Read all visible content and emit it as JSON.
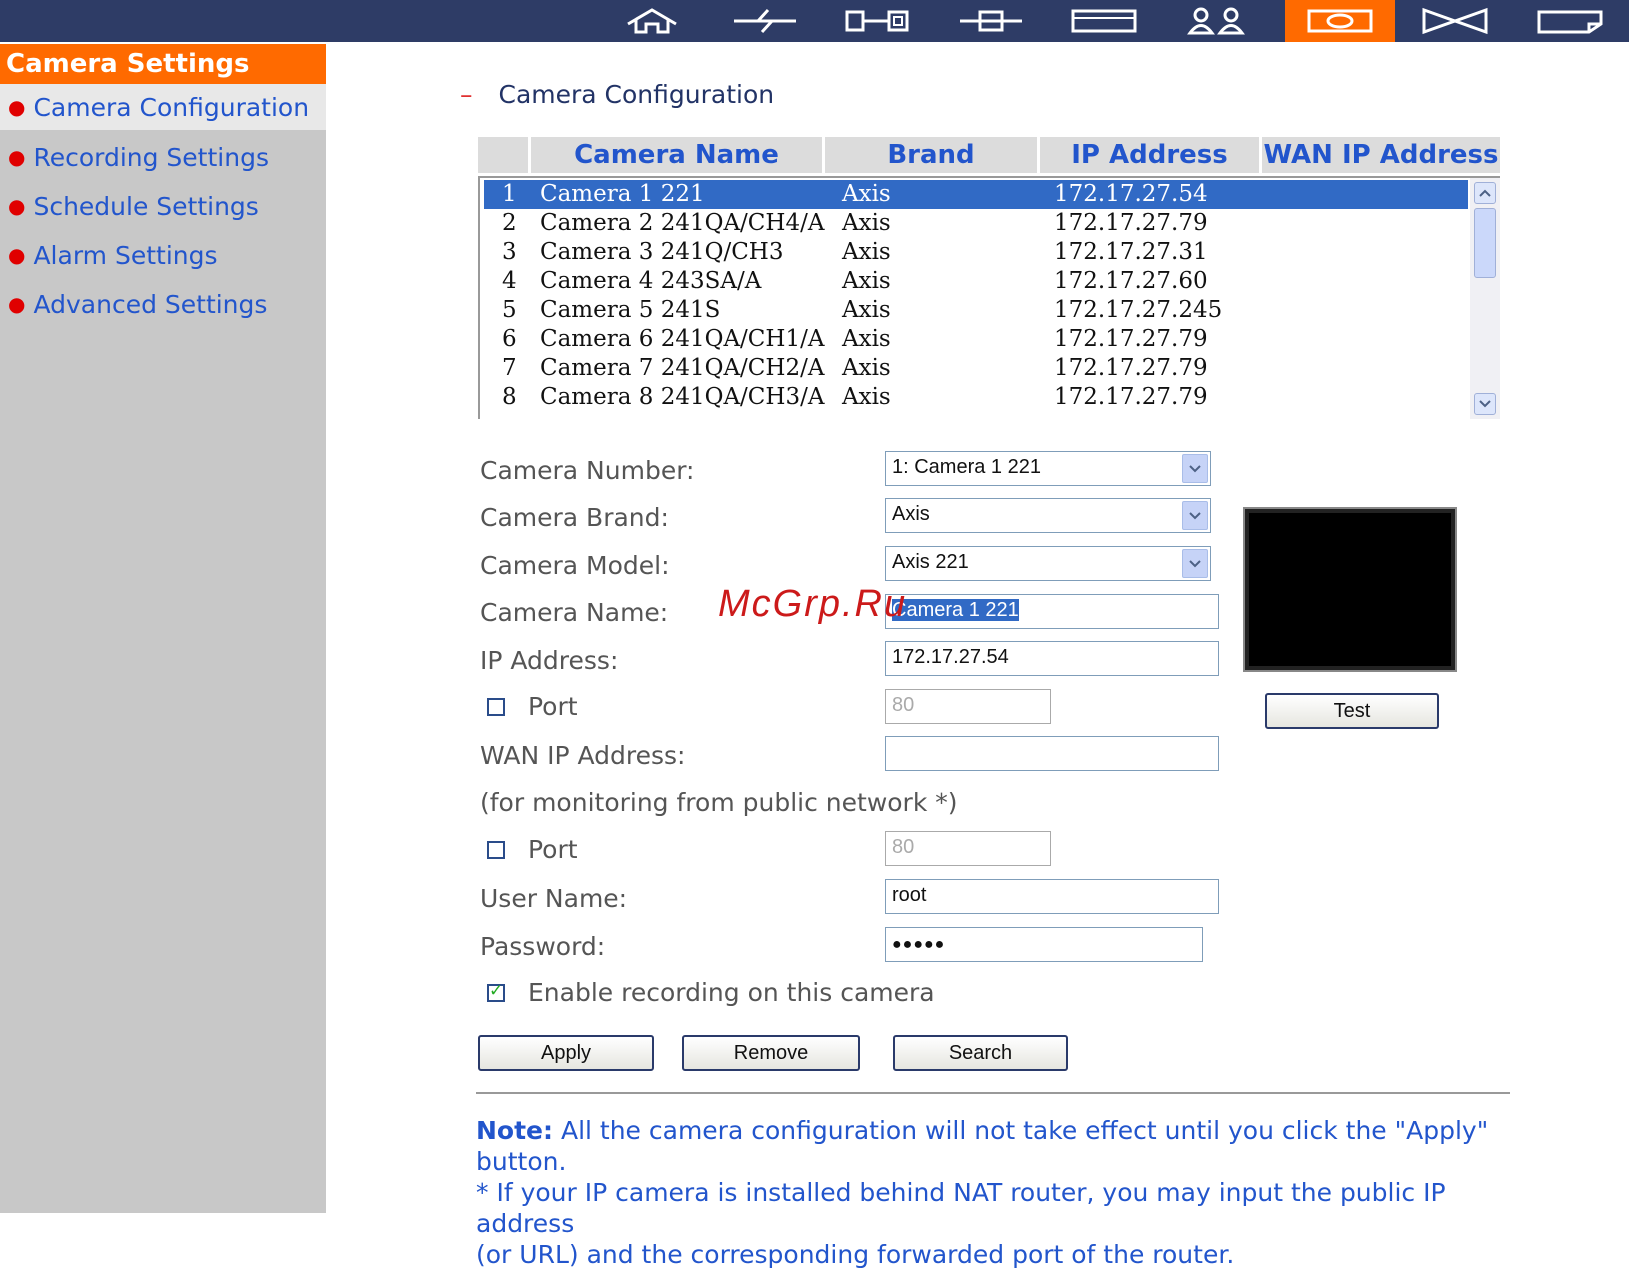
{
  "topbar": {
    "icons": [
      "home-icon",
      "network-icon",
      "device-icon",
      "plugin-icon",
      "window-icon",
      "users-icon",
      "camera-icon",
      "hourglass-icon",
      "monitor-icon"
    ],
    "active_index": 6,
    "bg_color": "#2e3c66",
    "active_color": "#ff6a00"
  },
  "sidebar": {
    "header": "Camera Settings",
    "items": [
      {
        "label": "Camera Configuration",
        "active": true
      },
      {
        "label": "Recording Settings",
        "active": false
      },
      {
        "label": "Schedule Settings",
        "active": false
      },
      {
        "label": "Alarm Settings",
        "active": false
      },
      {
        "label": "Advanced Settings",
        "active": false
      }
    ]
  },
  "main": {
    "dash": "–",
    "title": "Camera Configuration",
    "table": {
      "headers": [
        "",
        "Camera Name",
        "Brand",
        "IP Address",
        "WAN IP Address"
      ],
      "rows": [
        {
          "num": "1",
          "name": "Camera 1 221",
          "brand": "Axis",
          "ip": "172.17.27.54",
          "wan": ""
        },
        {
          "num": "2",
          "name": "Camera 2 241QA/CH4/A",
          "brand": "Axis",
          "ip": "172.17.27.79",
          "wan": ""
        },
        {
          "num": "3",
          "name": "Camera 3 241Q/CH3",
          "brand": "Axis",
          "ip": "172.17.27.31",
          "wan": ""
        },
        {
          "num": "4",
          "name": "Camera 4 243SA/A",
          "brand": "Axis",
          "ip": "172.17.27.60",
          "wan": ""
        },
        {
          "num": "5",
          "name": "Camera 5 241S",
          "brand": "Axis",
          "ip": "172.17.27.245",
          "wan": ""
        },
        {
          "num": "6",
          "name": "Camera 6 241QA/CH1/A",
          "brand": "Axis",
          "ip": "172.17.27.79",
          "wan": ""
        },
        {
          "num": "7",
          "name": "Camera 7 241QA/CH2/A",
          "brand": "Axis",
          "ip": "172.17.27.79",
          "wan": ""
        },
        {
          "num": "8",
          "name": "Camera 8 241QA/CH3/A",
          "brand": "Axis",
          "ip": "172.17.27.79",
          "wan": ""
        }
      ],
      "selected_row": 0
    },
    "form": {
      "camera_number_label": "Camera Number:",
      "camera_number_value": "1: Camera 1 221",
      "camera_brand_label": "Camera Brand:",
      "camera_brand_value": "Axis",
      "camera_model_label": "Camera Model:",
      "camera_model_value": "Axis 221",
      "camera_name_label": "Camera Name:",
      "camera_name_value": "Camera 1 221",
      "ip_label": "IP Address:",
      "ip_value": "172.17.27.54",
      "port_label": "Port",
      "port_value": "80",
      "port_checked": false,
      "wan_label": "WAN IP Address:",
      "wan_value": "",
      "wan_hint": "(for monitoring from public network *)",
      "wan_port_label": "Port",
      "wan_port_value": "80",
      "wan_port_checked": false,
      "user_label": "User Name:",
      "user_value": "root",
      "password_label": "Password:",
      "password_value": "●●●●●",
      "enable_label": "Enable recording on this camera",
      "enable_checked": true
    },
    "buttons": {
      "test": "Test",
      "apply": "Apply",
      "remove": "Remove",
      "search": "Search"
    },
    "note": {
      "title": "Note:",
      "line1": "All the camera configuration will not take effect until you click the \"Apply\" button.",
      "line2": "* If your IP camera is installed behind NAT router, you may input the public IP address",
      "line3": "(or URL) and the corresponding forwarded port of the router."
    },
    "watermark": "McGrp.Ru"
  }
}
